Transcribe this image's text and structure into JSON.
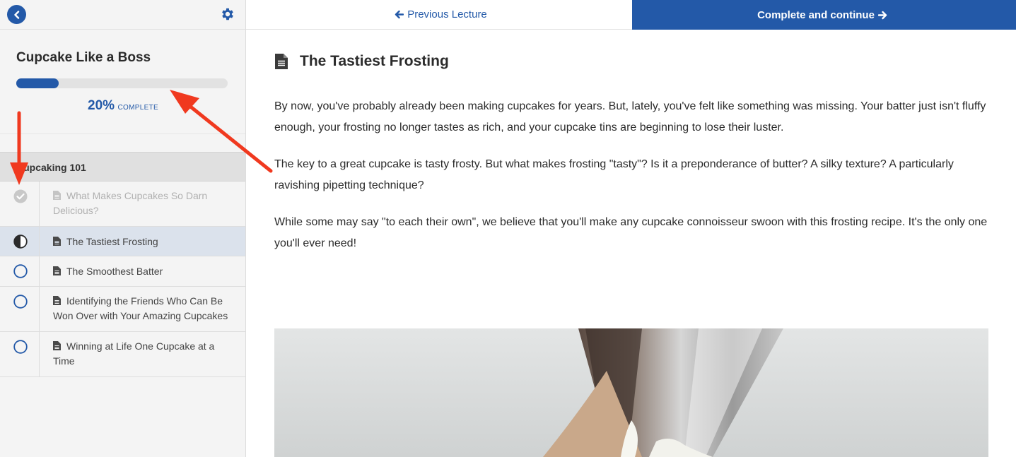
{
  "sidebar": {
    "course_title": "Cupcake Like a Boss",
    "progress_percent": 20,
    "progress_pct_text": "20%",
    "progress_complete_text": "COMPLETE",
    "section_title": "Cupcaking 101",
    "lessons": [
      {
        "label": "What Makes Cupcakes So Darn Delicious?",
        "status": "complete"
      },
      {
        "label": "The Tastiest Frosting",
        "status": "in-progress"
      },
      {
        "label": "The Smoothest Batter",
        "status": "not-started"
      },
      {
        "label": "Identifying the Friends Who Can Be Won Over with Your Amazing Cupcakes",
        "status": "not-started"
      },
      {
        "label": "Winning at Life One Cupcake at a Time",
        "status": "not-started"
      }
    ]
  },
  "topbar": {
    "prev_label": "Previous Lecture",
    "next_label": "Complete and continue"
  },
  "lecture": {
    "title": "The Tastiest Frosting",
    "paragraphs": [
      "By now, you've probably already been making cupcakes for years. But, lately, you've felt like something was missing. Your batter just isn't fluffy enough, your frosting no longer tastes as rich, and your cupcake tins are beginning to lose their luster.",
      "The key to a great cupcake is tasty frosty. But what makes frosting \"tasty\"? Is it a preponderance of butter? A silky texture? A particularly ravishing pipetting technique?",
      "While some may say \"to each their own\", we believe that you'll make any cupcake connoisseur swoon with this frosting recipe. It's the only one you'll ever need!"
    ]
  },
  "colors": {
    "brand_blue": "#2359a8",
    "annotation_red": "#f0391f"
  }
}
